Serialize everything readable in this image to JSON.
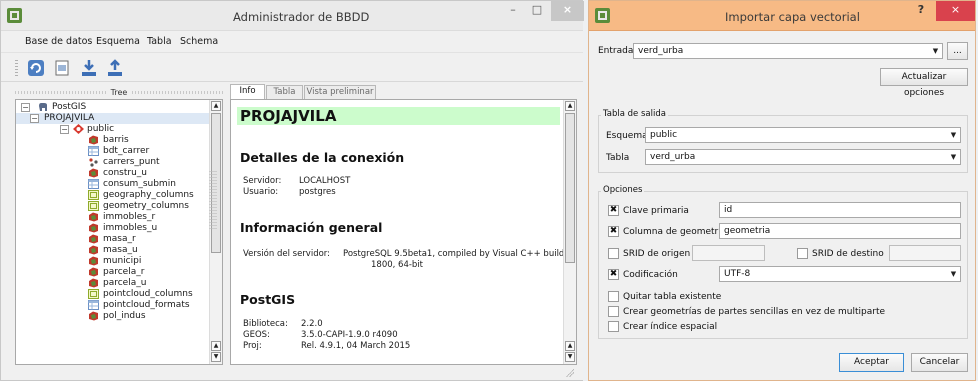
{
  "left_window": {
    "title": "Administrador de BBDD",
    "controls": {
      "minimize": "–",
      "maximize": "□",
      "close": "×"
    },
    "menu": [
      "Base de datos",
      "Esquema",
      "Tabla",
      "Schema"
    ],
    "tree_header": "Tree",
    "tree": {
      "root": "PostGIS",
      "connection": "PROJAJVILA",
      "schema": "public",
      "tables": [
        "barris",
        "bdt_carrer",
        "carrers_punt",
        "constru_u",
        "consum_submin",
        "geography_columns",
        "geometry_columns",
        "immobles_r",
        "immobles_u",
        "masa_r",
        "masa_u",
        "municipi",
        "parcela_r",
        "parcela_u",
        "pointcloud_columns",
        "pointcloud_formats",
        "pol_indus"
      ]
    },
    "tabs": [
      "Info",
      "Tabla",
      "Vista preliminar"
    ],
    "info": {
      "db_name": "PROJAJVILA",
      "connection_heading": "Detalles de la conexión",
      "server_label": "Servidor:",
      "server_value": "LOCALHOST",
      "user_label": "Usuario:",
      "user_value": "postgres",
      "general_heading": "Información general",
      "version_label": "Versión del servidor:",
      "version_value_1": "PostgreSQL 9.5beta1, compiled by Visual C++ build",
      "version_value_2": "1800, 64-bit",
      "postgis_heading": "PostGIS",
      "library_label": "Biblioteca:",
      "library_value": "2.2.0",
      "geos_label": "GEOS:",
      "geos_value": "3.5.0-CAPI-1.9.0 r4090",
      "proj_label": "Proj:",
      "proj_value": "Rel. 4.9.1, 04 March 2015"
    }
  },
  "dialog": {
    "title": "Importar capa vectorial",
    "controls": {
      "help": "?",
      "close": "×"
    },
    "input_label": "Entrada",
    "input_value": "verd_urba",
    "browse_button": "...",
    "update_button": "Actualizar opciones",
    "output_group": "Tabla de salida",
    "schema_label": "Esquema",
    "schema_value": "public",
    "table_label": "Tabla",
    "table_value": "verd_urba",
    "options_group": "Opciones",
    "primary_key_label": "Clave primaria",
    "primary_key_value": "id",
    "geometry_col_label": "Columna de geometría",
    "geometry_col_value": "geometria",
    "srid_source_label": "SRID de origen",
    "srid_target_label": "SRID de destino",
    "encoding_label": "Codificación",
    "encoding_value": "UTF-8",
    "drop_table_label": "Quitar tabla existente",
    "single_parts_label": "Crear geometrías de partes sencillas en vez de multiparte",
    "spatial_index_label": "Crear índice espacial",
    "accept_button": "Aceptar",
    "cancel_button": "Cancelar",
    "checked_mark": "✖"
  },
  "colors": {
    "dialog_titlebar": "#f7ba85",
    "db_banner": "#ccfccc",
    "close_red": "#d9424d"
  }
}
